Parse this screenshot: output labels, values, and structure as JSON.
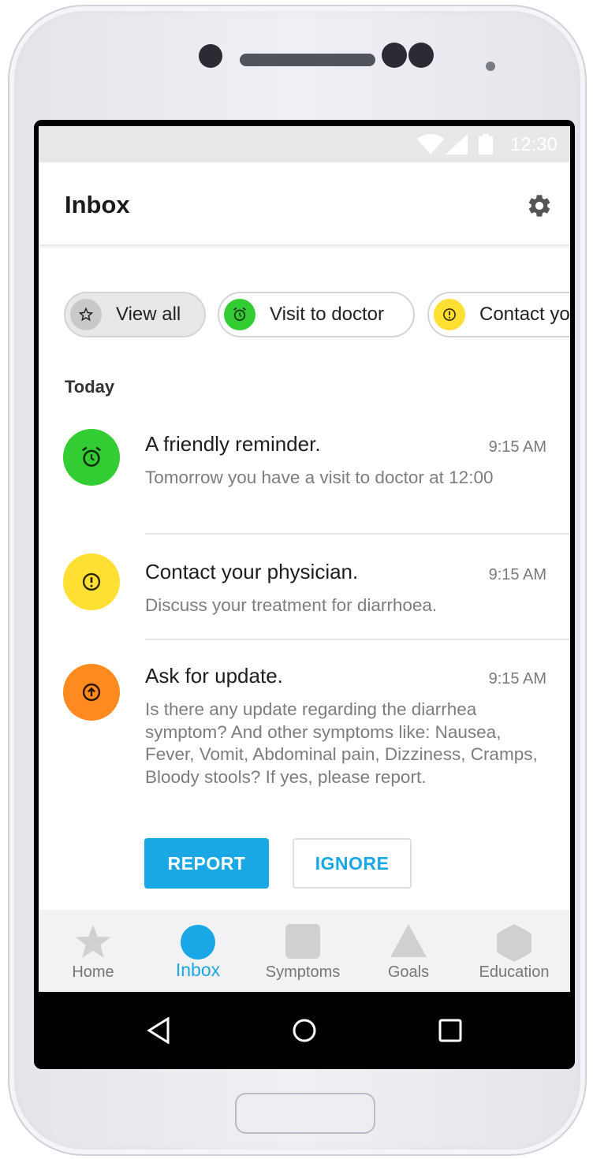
{
  "status_bar": {
    "time": "12:30",
    "icons": [
      "wifi-icon",
      "signal-icon",
      "battery-icon"
    ]
  },
  "header": {
    "title": "Inbox",
    "settings_icon": "gear-icon"
  },
  "filters": [
    {
      "label": "View all",
      "icon": "star-icon",
      "icon_bg": "#c9c9cb",
      "selected": true
    },
    {
      "label": "Visit to doctor",
      "icon": "alarm-clock-icon",
      "icon_bg": "#33cc33",
      "selected": false
    },
    {
      "label": "Contact your physician",
      "icon": "exclamation-icon",
      "icon_bg": "#ffe033",
      "selected": false
    }
  ],
  "section_title": "Today",
  "messages": [
    {
      "title": "A friendly reminder.",
      "time": "9:15 AM",
      "body": "Tomorrow you have a visit to doctor at 12:00",
      "icon": "alarm-clock-icon",
      "color": "#33cc33"
    },
    {
      "title": "Contact your physician.",
      "time": "9:15 AM",
      "body": "Discuss your treatment for diarrhoea.",
      "icon": "exclamation-icon",
      "color": "#ffe033"
    },
    {
      "title": "Ask for update.",
      "time": "9:15 AM",
      "body": "Is there any update regarding the diarrhea symptom? And other symptoms like: Nausea, Fever, Vomit, Abdominal pain, Dizziness, Cramps, Bloody stools? If yes, please report.",
      "icon": "arrow-up-icon",
      "color": "#ff8a1f",
      "actions": {
        "primary": "REPORT",
        "secondary": "IGNORE"
      }
    }
  ],
  "bottom_nav": [
    {
      "label": "Home",
      "icon": "star-icon",
      "active": false
    },
    {
      "label": "Inbox",
      "icon": "circle-icon",
      "active": true
    },
    {
      "label": "Symptoms",
      "icon": "square-icon",
      "active": false
    },
    {
      "label": "Goals",
      "icon": "triangle-icon",
      "active": false
    },
    {
      "label": "Education",
      "icon": "hexagon-icon",
      "active": false
    }
  ],
  "system_nav": [
    "back-icon",
    "home-icon",
    "recents-icon"
  ],
  "colors": {
    "accent": "#1aa7e6",
    "green": "#33cc33",
    "yellow": "#ffe033",
    "orange": "#ff8a1f"
  }
}
